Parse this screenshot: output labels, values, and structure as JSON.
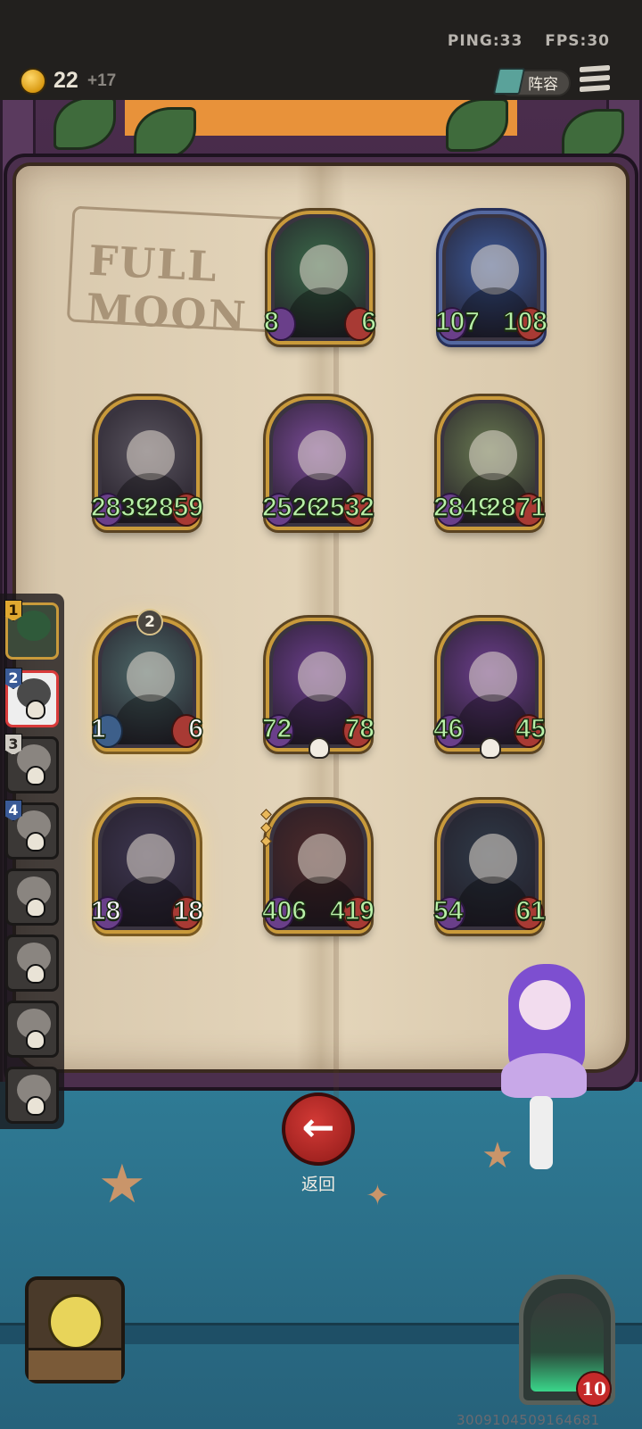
{
  "topbar": {
    "ping": "PING:33",
    "fps": "FPS:30",
    "coins": "22",
    "coin_delta": "+17",
    "lineup_label": "阵容"
  },
  "book": {
    "title": "FULL MOON"
  },
  "shop_cards": [
    {
      "atk": "8",
      "hp": "6",
      "theme": "#3b6b4a"
    },
    {
      "atk": "107",
      "hp": "108",
      "theme": "#3d5a9a"
    }
  ],
  "warband": [
    {
      "atk": "2839",
      "hp": "2859",
      "theme": "#5a5560"
    },
    {
      "atk": "2526",
      "hp": "2532",
      "theme": "#7c4c9a"
    },
    {
      "atk": "2849",
      "hp": "2871",
      "theme": "#6a7b52"
    }
  ],
  "row3": [
    {
      "atk": "1",
      "hp": "6",
      "tier": "2",
      "theme": "#4e6a6a"
    },
    {
      "atk": "72",
      "hp": "78",
      "theme": "#6d3f8e"
    },
    {
      "atk": "46",
      "hp": "45",
      "theme": "#6d3f8e"
    }
  ],
  "row4": [
    {
      "atk": "18",
      "hp": "18",
      "theme": "#3d3650"
    },
    {
      "atk": "406",
      "hp": "419",
      "theme": "#4d2a2a"
    },
    {
      "atk": "54",
      "hp": "61",
      "theme": "#2f3a48"
    }
  ],
  "roster": [
    "1",
    "2",
    "3",
    "4"
  ],
  "back_label": "返回",
  "back_icon": "arrow-left-icon",
  "player_level": "10",
  "debug_id": "3009104509164681"
}
